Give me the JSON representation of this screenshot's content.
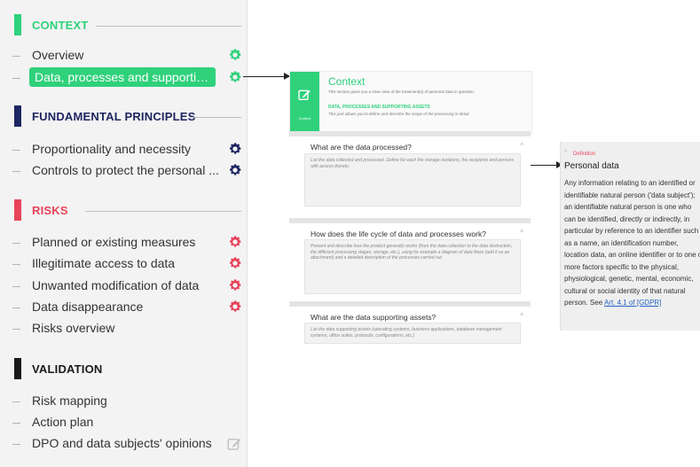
{
  "colors": {
    "green": "#2fd17b",
    "navy": "#1d2660",
    "red": "#e8445a",
    "black": "#1a1a1a"
  },
  "sidebar": {
    "sections": [
      {
        "title": "CONTEXT",
        "color": "#2fd17b"
      },
      {
        "title": "FUNDAMENTAL PRINCIPLES",
        "color": "#1d2660"
      },
      {
        "title": "RISKS",
        "color": "#e8445a"
      },
      {
        "title": "VALIDATION",
        "color": "#1a1a1a"
      }
    ],
    "items": [
      {
        "label": "Overview",
        "icon": "gear-icon",
        "icon_color": "#2fd17b"
      },
      {
        "label": "Data, processes and supporting ...",
        "icon": "gear-icon",
        "icon_color": "#2fd17b",
        "active": true
      },
      {
        "label": "Proportionality and necessity",
        "icon": "gear-icon",
        "icon_color": "#1d2660"
      },
      {
        "label": "Controls to protect the personal ...",
        "icon": "gear-icon",
        "icon_color": "#1d2660"
      },
      {
        "label": "Planned or existing measures",
        "icon": "gear-icon",
        "icon_color": "#e8445a"
      },
      {
        "label": "Illegitimate access to data",
        "icon": "gear-icon",
        "icon_color": "#e8445a"
      },
      {
        "label": "Unwanted modification of data",
        "icon": "gear-icon",
        "icon_color": "#e8445a"
      },
      {
        "label": "Data disappearance",
        "icon": "gear-icon",
        "icon_color": "#e8445a"
      },
      {
        "label": "Risks overview"
      },
      {
        "label": "Risk mapping"
      },
      {
        "label": "Action plan"
      },
      {
        "label": "DPO and data subjects' opinions",
        "icon": "pencil-icon",
        "icon_color": "#c4c4c4"
      }
    ]
  },
  "context": {
    "icon_caption": "Context",
    "title": "Context",
    "description": "This section gives you a clear view of the treatment(s) of personal data in question.",
    "subtitle": "DATA, PROCESSES AND SUPPORTING ASSETS",
    "subdescription": "This part allows you to define and describe the scope of the processing in detail.",
    "questions": [
      {
        "title": "What are the data processed?",
        "help": "List the data collected and processed. Define for each the storage durations, the recipients and persons with access thereto."
      },
      {
        "title": "How does the life cycle of data and processes work?",
        "help": "Present and describe how the product generally works (from the data collection to the data destruction, the different processing stages, storage, etc.), using for example a diagram of data flows (add it as an attachment) and a detailed description of the processes carried out."
      },
      {
        "title": "What are the data supporting assets?",
        "help": "List the data supporting assets (operating systems, business applications, database management systems, office suites, protocols, configurations, etc.)"
      }
    ]
  },
  "definition": {
    "label": "Definition",
    "term": "Personal data",
    "body": "Any information relating to an identified or identifiable natural person ('data subject'); an identifiable natural person is one who can be identified, directly or indirectly, in particular by reference to an identifier such as a name, an identification number, location data, an online identifier or to one or more factors specific to the physical, physiological, genetic, mental, economic, cultural or social identity of that natural person.",
    "see_prefix": "See",
    "link_text": "Art. 4.1 of [GDPR]"
  }
}
